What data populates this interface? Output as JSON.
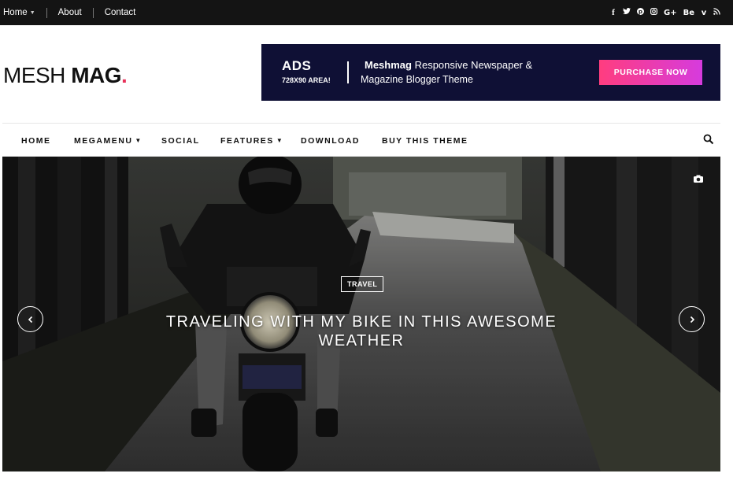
{
  "topnav": {
    "items": [
      {
        "label": "Home",
        "has_caret": true
      },
      {
        "label": "About"
      },
      {
        "label": "Contact"
      }
    ]
  },
  "social": [
    {
      "name": "facebook-icon",
      "glyph": "f"
    },
    {
      "name": "twitter-icon",
      "glyph": "🐦"
    },
    {
      "name": "pinterest-icon",
      "glyph": "p"
    },
    {
      "name": "instagram-icon",
      "glyph": "◎"
    },
    {
      "name": "googleplus-icon",
      "glyph": "G+"
    },
    {
      "name": "behance-icon",
      "glyph": "Be"
    },
    {
      "name": "vimeo-icon",
      "glyph": "v"
    },
    {
      "name": "rss-icon",
      "glyph": "≋"
    }
  ],
  "logo": {
    "part1": "MESH",
    "part2": "MAG",
    "dot": "."
  },
  "ad": {
    "ads": "ADS",
    "area": "728X90 AREA!",
    "line1_bold": "Meshmag",
    "line1_rest": " Responsive Newspaper &",
    "line2": "Magazine Blogger Theme",
    "button": "PURCHASE NOW"
  },
  "nav": {
    "home": "HOME",
    "megamenu": "MEGAMENU",
    "social": "SOCIAL",
    "features": "FEATURES",
    "download": "DOWNLOAD",
    "buy": "BUY THIS THEME"
  },
  "hero": {
    "category": "TRAVEL",
    "title": "TRAVELING WITH MY BIKE IN THIS AWESOME WEATHER"
  },
  "colors": {
    "accent": "#e8325a",
    "ad_bg": "#0f1035",
    "topbar_bg": "#141414",
    "button_gradient_start": "#ff3d7f",
    "button_gradient_end": "#d63bde"
  }
}
